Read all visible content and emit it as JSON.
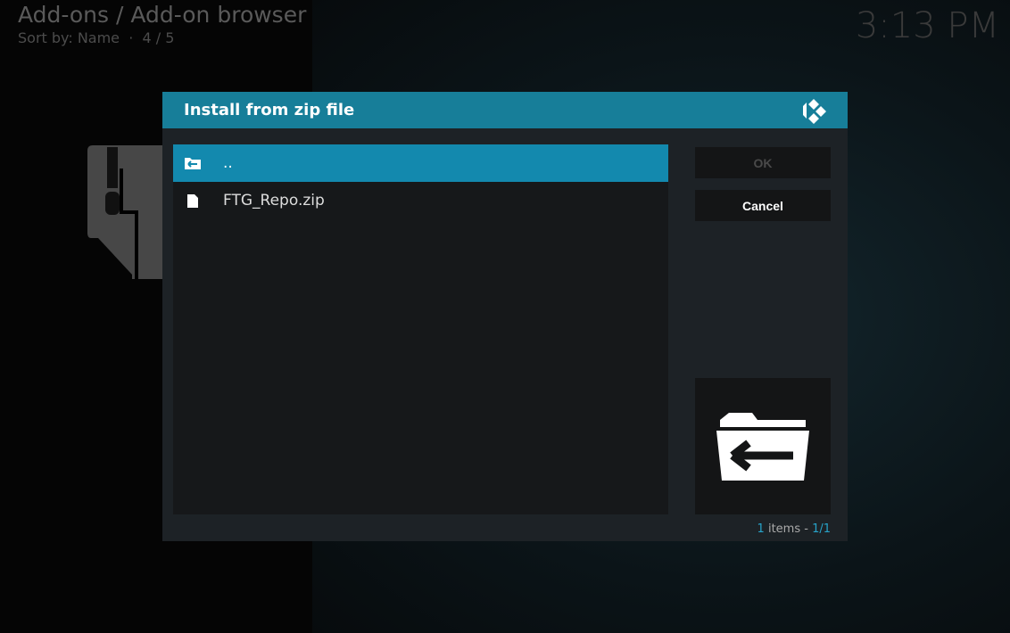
{
  "header": {
    "breadcrumb": "Add-ons / Add-on browser",
    "sort_label": "Sort by: Name",
    "separator": "·",
    "position": "4 / 5",
    "clock": "3:13 PM"
  },
  "dialog": {
    "title": "Install from zip file",
    "items": [
      {
        "label": "..",
        "icon": "folder-back-icon",
        "selected": true
      },
      {
        "label": "FTG_Repo.zip",
        "icon": "file-icon",
        "selected": false
      }
    ],
    "ok_label": "OK",
    "cancel_label": "Cancel",
    "count_num": "1",
    "count_text": "items -",
    "count_page": "1/1"
  },
  "colors": {
    "accent": "#177e99",
    "selection": "#1389ae"
  }
}
